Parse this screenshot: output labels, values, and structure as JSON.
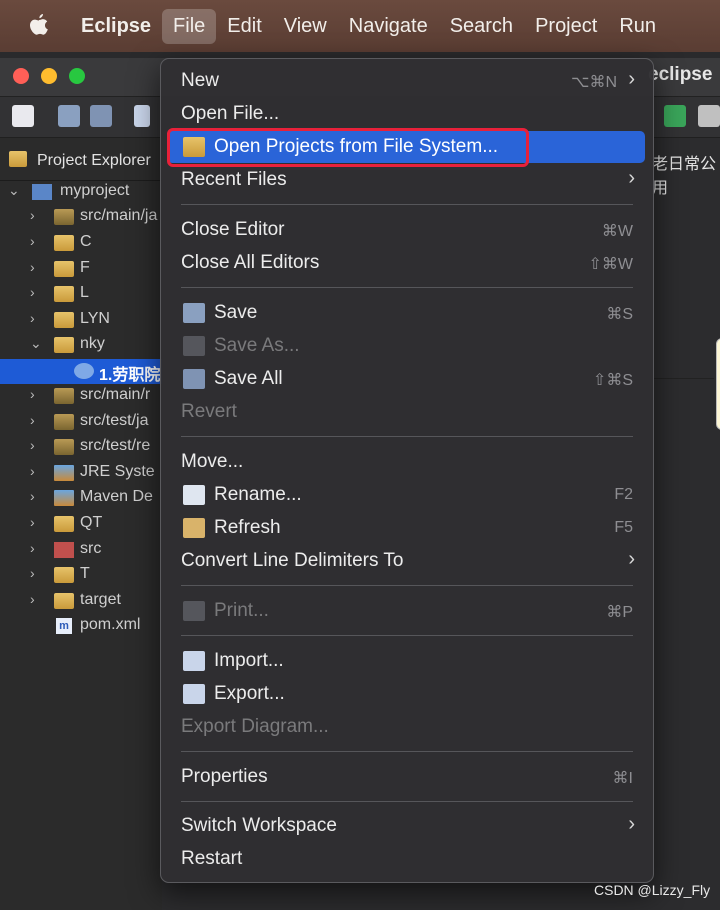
{
  "menubar": {
    "app": "Eclipse",
    "items": [
      "File",
      "Edit",
      "View",
      "Navigate",
      "Search",
      "Project",
      "Run"
    ]
  },
  "window": {
    "title": "eclipse"
  },
  "explorer": {
    "tab": "Project Explorer",
    "rows": [
      {
        "label": "myproject"
      },
      {
        "label": "src/main/ja"
      },
      {
        "label": "C"
      },
      {
        "label": "F"
      },
      {
        "label": "L"
      },
      {
        "label": "LYN"
      },
      {
        "label": "nky"
      },
      {
        "label": "1.劳职院"
      },
      {
        "label": "src/main/r"
      },
      {
        "label": "src/test/ja"
      },
      {
        "label": "src/test/re"
      },
      {
        "label": "JRE Syste"
      },
      {
        "label": "Maven De"
      },
      {
        "label": "QT"
      },
      {
        "label": "src"
      },
      {
        "label": "T"
      },
      {
        "label": "target"
      },
      {
        "label": "pom.xml"
      }
    ]
  },
  "right_panel_text": "老日常公用",
  "menu": {
    "new": {
      "label": "New",
      "shortcut": "⌥⌘N"
    },
    "open_file": {
      "label": "Open File..."
    },
    "open_projects": {
      "label": "Open Projects from File System..."
    },
    "recent_files": {
      "label": "Recent Files"
    },
    "close_editor": {
      "label": "Close Editor",
      "shortcut": "⌘W"
    },
    "close_all": {
      "label": "Close All Editors",
      "shortcut": "⇧⌘W"
    },
    "save": {
      "label": "Save",
      "shortcut": "⌘S"
    },
    "save_as": {
      "label": "Save As..."
    },
    "save_all": {
      "label": "Save All",
      "shortcut": "⇧⌘S"
    },
    "revert": {
      "label": "Revert"
    },
    "move": {
      "label": "Move..."
    },
    "rename": {
      "label": "Rename...",
      "shortcut": "F2"
    },
    "refresh": {
      "label": "Refresh",
      "shortcut": "F5"
    },
    "convert": {
      "label": "Convert Line Delimiters To"
    },
    "print": {
      "label": "Print...",
      "shortcut": "⌘P"
    },
    "import": {
      "label": "Import..."
    },
    "export": {
      "label": "Export..."
    },
    "export_diagram": {
      "label": "Export Diagram..."
    },
    "properties": {
      "label": "Properties",
      "shortcut": "⌘I"
    },
    "switch_workspace": {
      "label": "Switch Workspace"
    },
    "restart": {
      "label": "Restart"
    }
  },
  "watermark": "CSDN @Lizzy_Fly",
  "colors": {
    "highlight": "#2a64d8",
    "callout": "#e8213a",
    "selection": "#1e5bd6"
  }
}
